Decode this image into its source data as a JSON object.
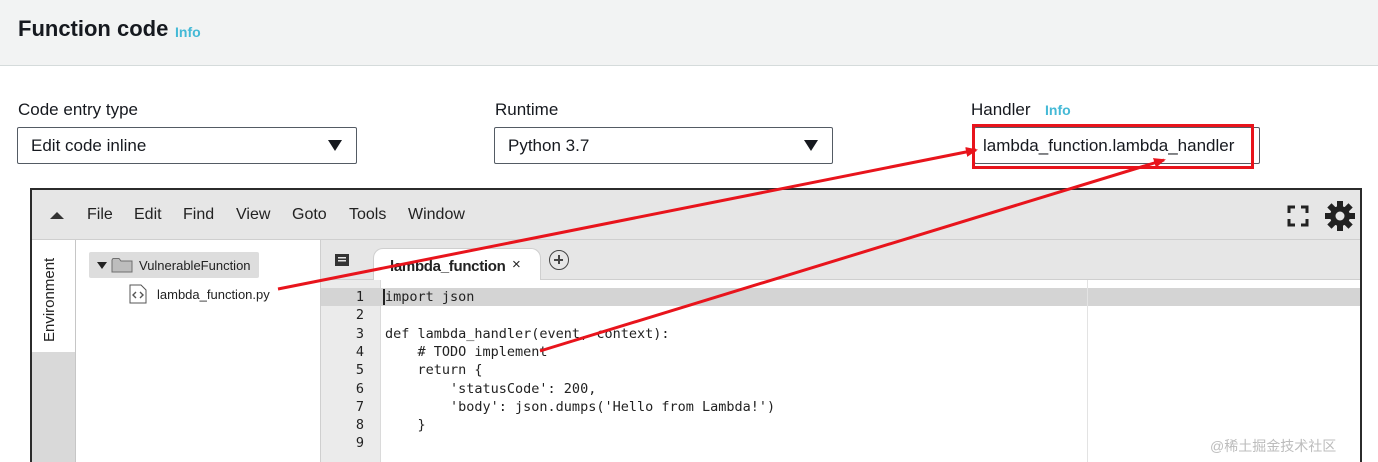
{
  "header": {
    "title": "Function code",
    "info_label": "Info"
  },
  "form": {
    "code_entry_type": {
      "label": "Code entry type",
      "value": "Edit code inline"
    },
    "runtime": {
      "label": "Runtime",
      "value": "Python 3.7"
    },
    "handler": {
      "label": "Handler",
      "info_label": "Info",
      "value": "lambda_function.lambda_handler"
    }
  },
  "ide": {
    "menu": [
      "File",
      "Edit",
      "Find",
      "View",
      "Goto",
      "Tools",
      "Window"
    ],
    "sidebar_tab": "Environment",
    "tree": {
      "folder": "VulnerableFunction",
      "file": "lambda_function.py"
    },
    "tab": {
      "label": "lambda_function",
      "close": "×"
    },
    "line_numbers": [
      "1",
      "2",
      "3",
      "4",
      "5",
      "6",
      "7",
      "8",
      "9"
    ],
    "code_lines": [
      "import json",
      "",
      "def lambda_handler(event, context):",
      "    # TODO implement",
      "    return {",
      "        'statusCode': 200,",
      "        'body': json.dumps('Hello from Lambda!')",
      "    }",
      ""
    ]
  },
  "watermark": "@稀土掘金技术社区",
  "colors": {
    "annotation_red": "#e8141c",
    "info_link": "#44b9d6",
    "header_bg": "#f2f3f3"
  },
  "icons": [
    "collapse-arrow-icon",
    "fullscreen-icon",
    "gear-icon",
    "folder-icon",
    "python-file-icon",
    "tab-list-icon",
    "add-tab-icon",
    "dropdown-arrow-icon"
  ]
}
